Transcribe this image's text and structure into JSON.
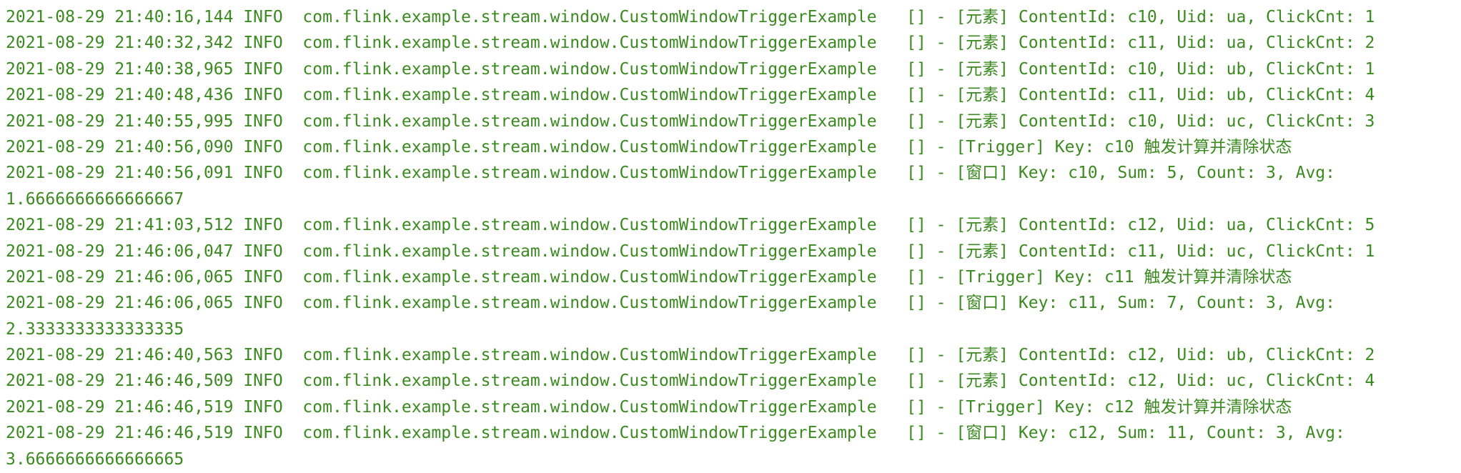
{
  "console": {
    "text_color": "#3a8a1f",
    "background": "#ffffff",
    "lines": [
      {
        "text": "2021-08-29 21:40:16,144 INFO  com.flink.example.stream.window.CustomWindowTriggerExample   [] - [元素] ContentId: c10, Uid: ua, ClickCnt: 1"
      },
      {
        "text": "2021-08-29 21:40:32,342 INFO  com.flink.example.stream.window.CustomWindowTriggerExample   [] - [元素] ContentId: c11, Uid: ua, ClickCnt: 2"
      },
      {
        "text": "2021-08-29 21:40:38,965 INFO  com.flink.example.stream.window.CustomWindowTriggerExample   [] - [元素] ContentId: c10, Uid: ub, ClickCnt: 1"
      },
      {
        "text": "2021-08-29 21:40:48,436 INFO  com.flink.example.stream.window.CustomWindowTriggerExample   [] - [元素] ContentId: c11, Uid: ub, ClickCnt: 4"
      },
      {
        "text": "2021-08-29 21:40:55,995 INFO  com.flink.example.stream.window.CustomWindowTriggerExample   [] - [元素] ContentId: c10, Uid: uc, ClickCnt: 3"
      },
      {
        "text": "2021-08-29 21:40:56,090 INFO  com.flink.example.stream.window.CustomWindowTriggerExample   [] - [Trigger] Key: c10 触发计算并清除状态"
      },
      {
        "text": "2021-08-29 21:40:56,091 INFO  com.flink.example.stream.window.CustomWindowTriggerExample   [] - [窗口] Key: c10, Sum: 5, Count: 3, Avg:"
      },
      {
        "text": "1.6666666666666667"
      },
      {
        "text": "2021-08-29 21:41:03,512 INFO  com.flink.example.stream.window.CustomWindowTriggerExample   [] - [元素] ContentId: c12, Uid: ua, ClickCnt: 5"
      },
      {
        "text": "2021-08-29 21:46:06,047 INFO  com.flink.example.stream.window.CustomWindowTriggerExample   [] - [元素] ContentId: c11, Uid: uc, ClickCnt: 1"
      },
      {
        "text": "2021-08-29 21:46:06,065 INFO  com.flink.example.stream.window.CustomWindowTriggerExample   [] - [Trigger] Key: c11 触发计算并清除状态"
      },
      {
        "text": "2021-08-29 21:46:06,065 INFO  com.flink.example.stream.window.CustomWindowTriggerExample   [] - [窗口] Key: c11, Sum: 7, Count: 3, Avg:"
      },
      {
        "text": "2.3333333333333335"
      },
      {
        "text": "2021-08-29 21:46:40,563 INFO  com.flink.example.stream.window.CustomWindowTriggerExample   [] - [元素] ContentId: c12, Uid: ub, ClickCnt: 2"
      },
      {
        "text": "2021-08-29 21:46:46,509 INFO  com.flink.example.stream.window.CustomWindowTriggerExample   [] - [元素] ContentId: c12, Uid: uc, ClickCnt: 4"
      },
      {
        "text": "2021-08-29 21:46:46,519 INFO  com.flink.example.stream.window.CustomWindowTriggerExample   [] - [Trigger] Key: c12 触发计算并清除状态"
      },
      {
        "text": "2021-08-29 21:46:46,519 INFO  com.flink.example.stream.window.CustomWindowTriggerExample   [] - [窗口] Key: c12, Sum: 11, Count: 3, Avg:"
      },
      {
        "text": "3.6666666666666665"
      }
    ]
  }
}
